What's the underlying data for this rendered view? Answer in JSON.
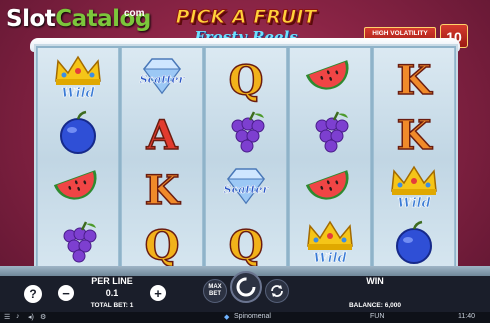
{
  "logo": {
    "slot": "Slot",
    "catalog": "Catalog",
    "com": "com"
  },
  "title": {
    "main": "PICK A FRUIT",
    "sub": "Frosty Reels"
  },
  "volatility": {
    "label": "HIGH VOLATILITY",
    "level": "10"
  },
  "reels": [
    [
      "wild",
      "plum",
      "watermelon",
      "grapes"
    ],
    [
      "scatter",
      "A",
      "K",
      "Q"
    ],
    [
      "Q",
      "grapes",
      "scatter",
      "Q"
    ],
    [
      "watermelon",
      "grapes",
      "watermelon",
      "wild"
    ],
    [
      "K",
      "K",
      "wild",
      "plum"
    ]
  ],
  "symbol_text": {
    "wild": "Wild",
    "scatter": "Scatter"
  },
  "controls": {
    "help": "?",
    "per_line_label": "PER LINE",
    "per_line_value": "0.1",
    "minus": "−",
    "plus": "+",
    "total_bet": "TOTAL BET: 1",
    "max_bet": "MAX BET",
    "win_label": "WIN",
    "balance": "BALANCE: 6,000"
  },
  "footer": {
    "brand": "Spinomenal",
    "mode": "FUN",
    "time": "11:40"
  },
  "colors": {
    "accent": "#ffd23a",
    "background": "#8a2445",
    "bar": "#1a1e2a"
  }
}
